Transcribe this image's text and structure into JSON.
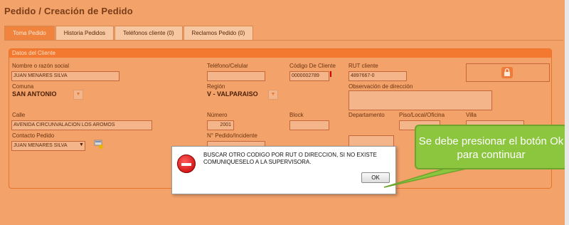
{
  "page": {
    "title": "Pedido / Creación de Pedido"
  },
  "tabs": [
    {
      "label": "Toma Pedido",
      "active": true
    },
    {
      "label": "Historia Pedidos",
      "active": false
    },
    {
      "label": "Teléfonos cliente (0)",
      "active": false
    },
    {
      "label": "Reclamos Pedido (0)",
      "active": false
    }
  ],
  "panel": {
    "title": "Datos del Cliente"
  },
  "form": {
    "nombre_label": "Nombre o razón social",
    "nombre_value": "JUAN MENARES SILVA",
    "telefono_label": "Teléfono/Celular",
    "telefono_value": "",
    "codigo_label": "Código De Cliente",
    "codigo_value": "0000002789",
    "rut_label": "RUT cliente",
    "rut_value": "4897667-0",
    "comuna_label": "Comuna",
    "comuna_value": "SAN ANTONIO",
    "region_label": "Región",
    "region_value": "V - VALPARAISO",
    "observacion_label": "Observación de dirección",
    "observacion_value": "",
    "calle_label": "Calle",
    "calle_value": "AVENIDA CIRCUNVALACION LOS AROMOS",
    "numero_label": "Número",
    "numero_value": "2001",
    "block_label": "Block",
    "departamento_label": "Departamento",
    "piso_label": "Piso/Local/Oficina",
    "villa_label": "Villa",
    "contacto_label": "Contacto Pedido",
    "contacto_value": "JUAN MENARES SILVA",
    "incidente_label": "N° Pedido/Incidente"
  },
  "dialog": {
    "message": "BUSCAR OTRO CODIGO POR RUT O DIRECCION, SI NO EXISTE COMUNIQUESELO A LA SUPERVISORA.",
    "ok_label": "OK"
  },
  "callout": {
    "text": "Se debe presionar el botón Ok para continuar"
  },
  "colors": {
    "accent": "#f2792f",
    "callout": "#8cc63e",
    "background": "#f3a26a"
  }
}
